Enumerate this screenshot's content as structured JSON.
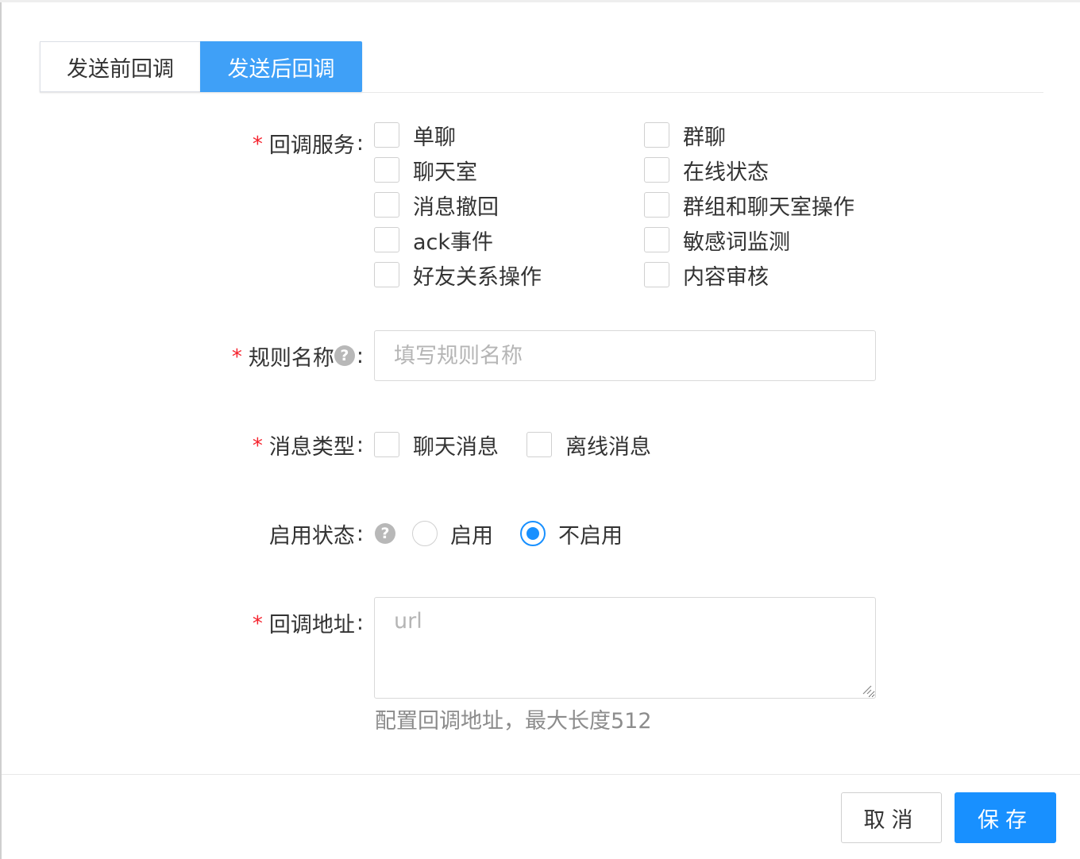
{
  "tabs": [
    {
      "label": "发送前回调"
    },
    {
      "label": "发送后回调",
      "active": true
    }
  ],
  "form": {
    "callback_services": {
      "label": "回调服务",
      "required": true,
      "options": [
        {
          "label": "单聊",
          "checked": false
        },
        {
          "label": "群聊",
          "checked": false
        },
        {
          "label": "聊天室",
          "checked": false
        },
        {
          "label": "在线状态",
          "checked": false
        },
        {
          "label": "消息撤回",
          "checked": false
        },
        {
          "label": "群组和聊天室操作",
          "checked": false
        },
        {
          "label": "ack事件",
          "checked": false
        },
        {
          "label": "敏感词监测",
          "checked": false
        },
        {
          "label": "好友关系操作",
          "checked": false
        },
        {
          "label": "内容审核",
          "checked": false
        }
      ]
    },
    "rule_name": {
      "label": "规则名称",
      "required": true,
      "help_icon": "question-icon",
      "placeholder": "填写规则名称",
      "value": ""
    },
    "message_type": {
      "label": "消息类型",
      "required": true,
      "options": [
        {
          "label": "聊天消息",
          "checked": false
        },
        {
          "label": "离线消息",
          "checked": false
        }
      ]
    },
    "enable_status": {
      "label": "启用状态",
      "required": false,
      "help_icon": "question-icon",
      "options": [
        {
          "label": "启用",
          "checked": false
        },
        {
          "label": "不启用",
          "checked": true
        }
      ]
    },
    "callback_url": {
      "label": "回调地址",
      "required": true,
      "placeholder": "url",
      "value": "",
      "hint": "配置回调地址，最大长度512"
    }
  },
  "footer": {
    "cancel_label": "取消",
    "save_label": "保存"
  },
  "colors": {
    "primary": "#1890ff",
    "active_tab": "#3fa0f7",
    "required": "#f5222d"
  }
}
